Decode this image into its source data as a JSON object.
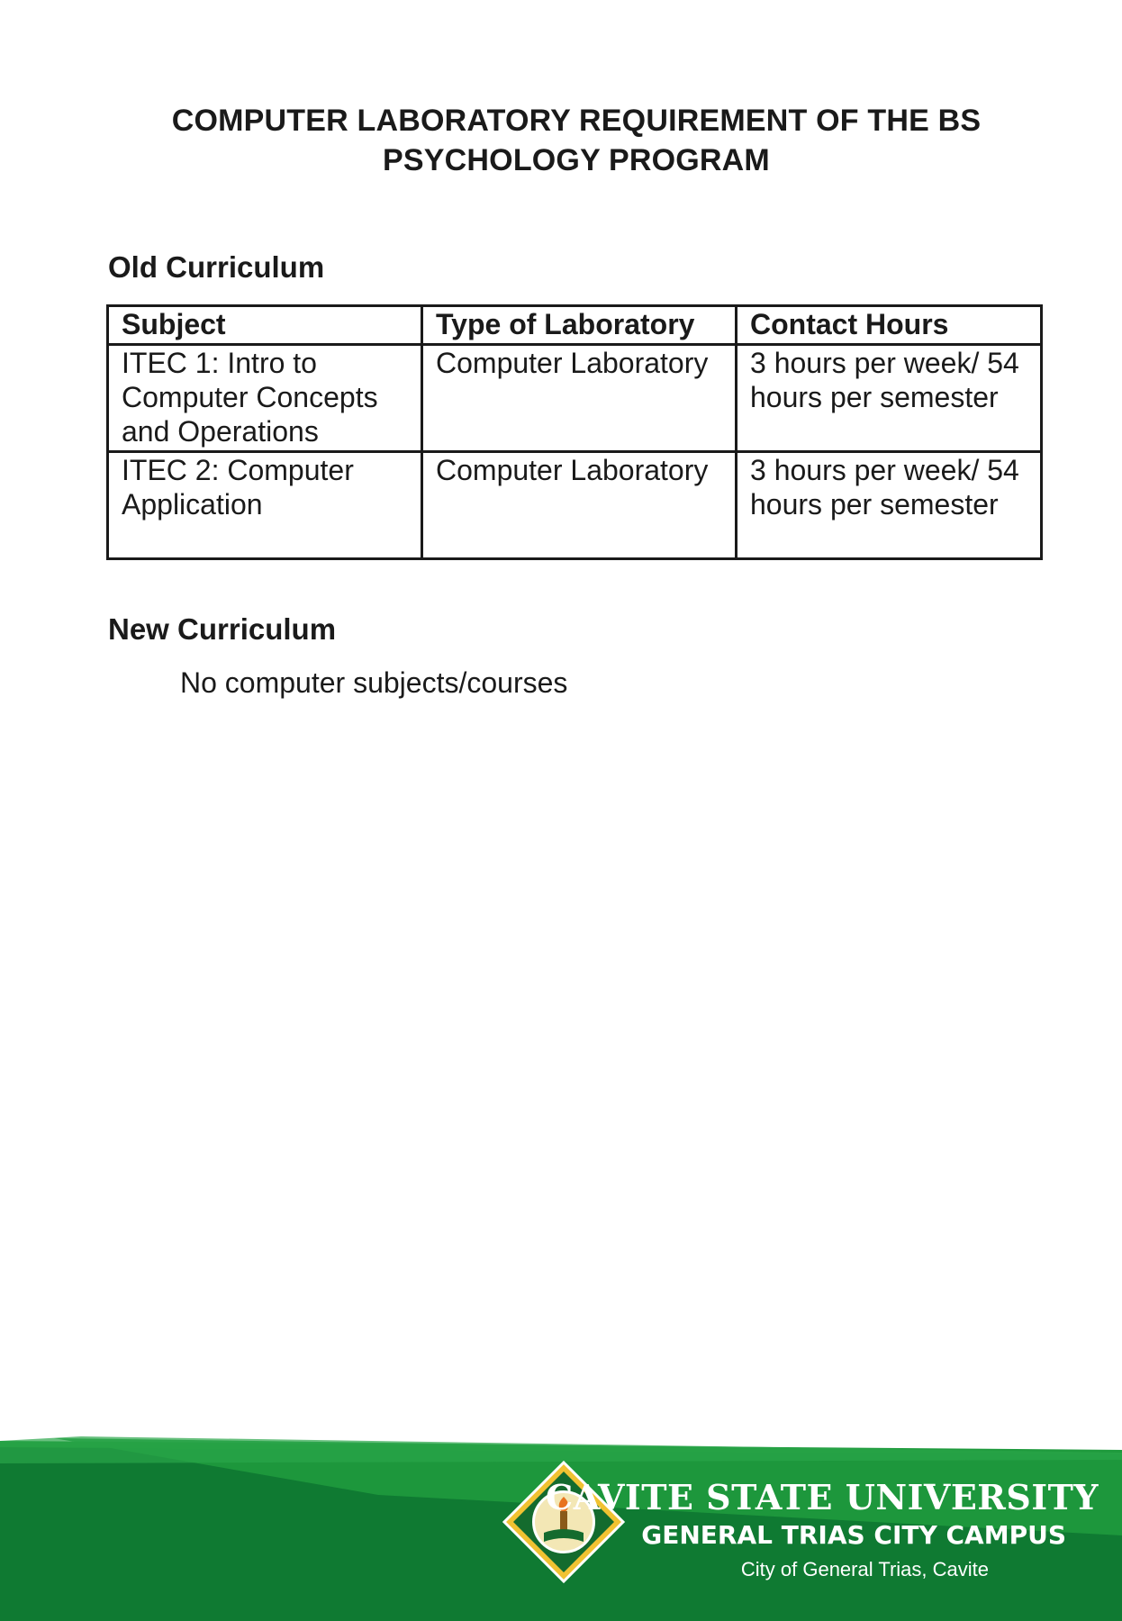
{
  "document": {
    "title_line1": "COMPUTER LABORATORY REQUIREMENT OF THE BS",
    "title_line2": "PSYCHOLOGY PROGRAM",
    "old_curriculum": {
      "heading": "Old Curriculum",
      "headers": [
        "Subject",
        "Type of Laboratory",
        "Contact Hours"
      ],
      "rows": [
        {
          "subject": "ITEC 1: Intro to Computer Concepts and Operations",
          "lab_type": "Computer Laboratory",
          "hours": "3 hours per week/ 54 hours per semester"
        },
        {
          "subject": "ITEC 2: Computer Application",
          "lab_type": "Computer Laboratory",
          "hours": "3 hours per week/ 54 hours per semester"
        }
      ]
    },
    "new_curriculum": {
      "heading": "New Curriculum",
      "body": "No computer subjects/courses"
    }
  },
  "footer": {
    "university": "CAVITE STATE UNIVERSITY",
    "campus": "GENERAL TRIAS CITY CAMPUS",
    "city": "City of General Trias, Cavite",
    "seal_icon": "university-seal-icon",
    "colors": {
      "green_dark": "#0f7a32",
      "green_light": "#1f9a3d"
    }
  }
}
